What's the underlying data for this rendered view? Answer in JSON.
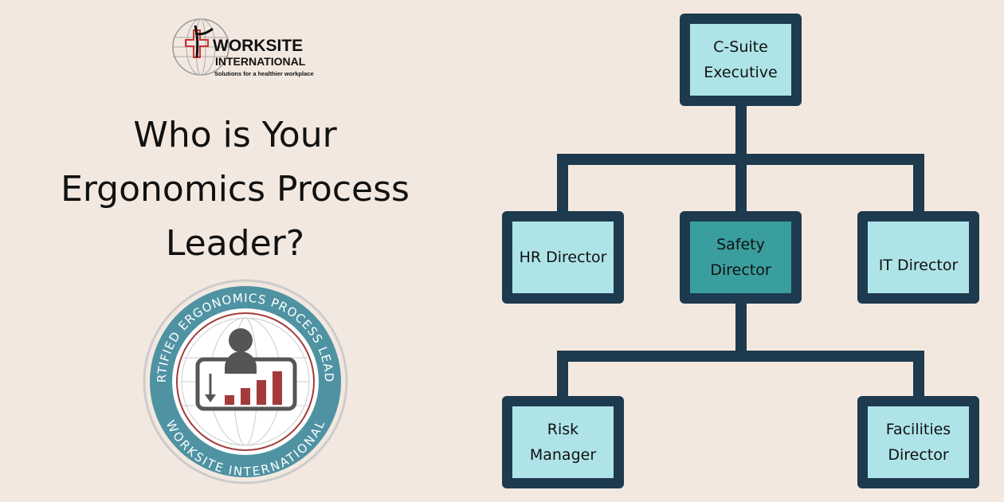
{
  "logo": {
    "name": "WORKSITE",
    "name2": "INTERNATIONAL",
    "tagline": "Solutions for a healthier workplace"
  },
  "headline": [
    "Who is Your",
    "Ergonomics Process",
    "Leader?"
  ],
  "badge": {
    "top_text": "CERTIFIED ERGONOMICS PROCESS LEADER",
    "bottom_text": "WORKSITE INTERNATIONAL"
  },
  "org": {
    "top": [
      "C-Suite",
      "Executive"
    ],
    "hr": [
      "HR Director"
    ],
    "safety": [
      "Safety",
      "Director"
    ],
    "it": [
      "IT Director"
    ],
    "risk": [
      "Risk",
      "Manager"
    ],
    "facilities": [
      "Facilities",
      "Director"
    ]
  },
  "colors": {
    "background": "#f3e8e0",
    "connector": "#1d3a4e",
    "box": "#aee4e8",
    "highlight": "#3a9e9f",
    "badge_ring": "#4f93a3",
    "accent_red": "#a33b3b"
  }
}
